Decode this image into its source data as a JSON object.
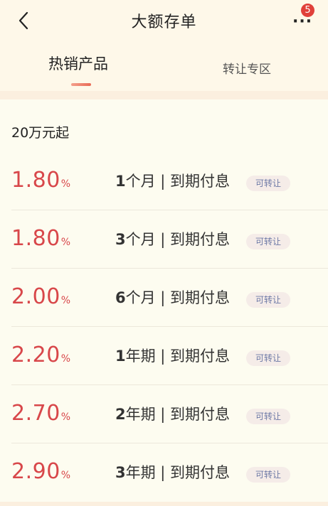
{
  "header": {
    "title": "大额存单",
    "more_dots": "···",
    "badge_count": "5"
  },
  "tabs": [
    {
      "label": "热销产品",
      "active": true
    },
    {
      "label": "转让专区",
      "active": false
    }
  ],
  "section_title": "20万元起",
  "products": [
    {
      "rate": "1.80",
      "unit": "%",
      "term_num": "1",
      "term_rest": "个月 | 到期付息",
      "tag": "可转让"
    },
    {
      "rate": "1.80",
      "unit": "%",
      "term_num": "3",
      "term_rest": "个月 | 到期付息",
      "tag": "可转让"
    },
    {
      "rate": "2.00",
      "unit": "%",
      "term_num": "6",
      "term_rest": "个月 | 到期付息",
      "tag": "可转让"
    },
    {
      "rate": "2.20",
      "unit": "%",
      "term_num": "1",
      "term_rest": "年期 | 到期付息",
      "tag": "可转让"
    },
    {
      "rate": "2.70",
      "unit": "%",
      "term_num": "2",
      "term_rest": "年期 | 到期付息",
      "tag": "可转让"
    },
    {
      "rate": "2.90",
      "unit": "%",
      "term_num": "3",
      "term_rest": "年期 | 到期付息",
      "tag": "可转让"
    }
  ],
  "colors": {
    "accent_rate": "#d8474a",
    "badge": "#e0403a",
    "tag_text": "#6d79a6",
    "background": "#fdfcf0"
  }
}
